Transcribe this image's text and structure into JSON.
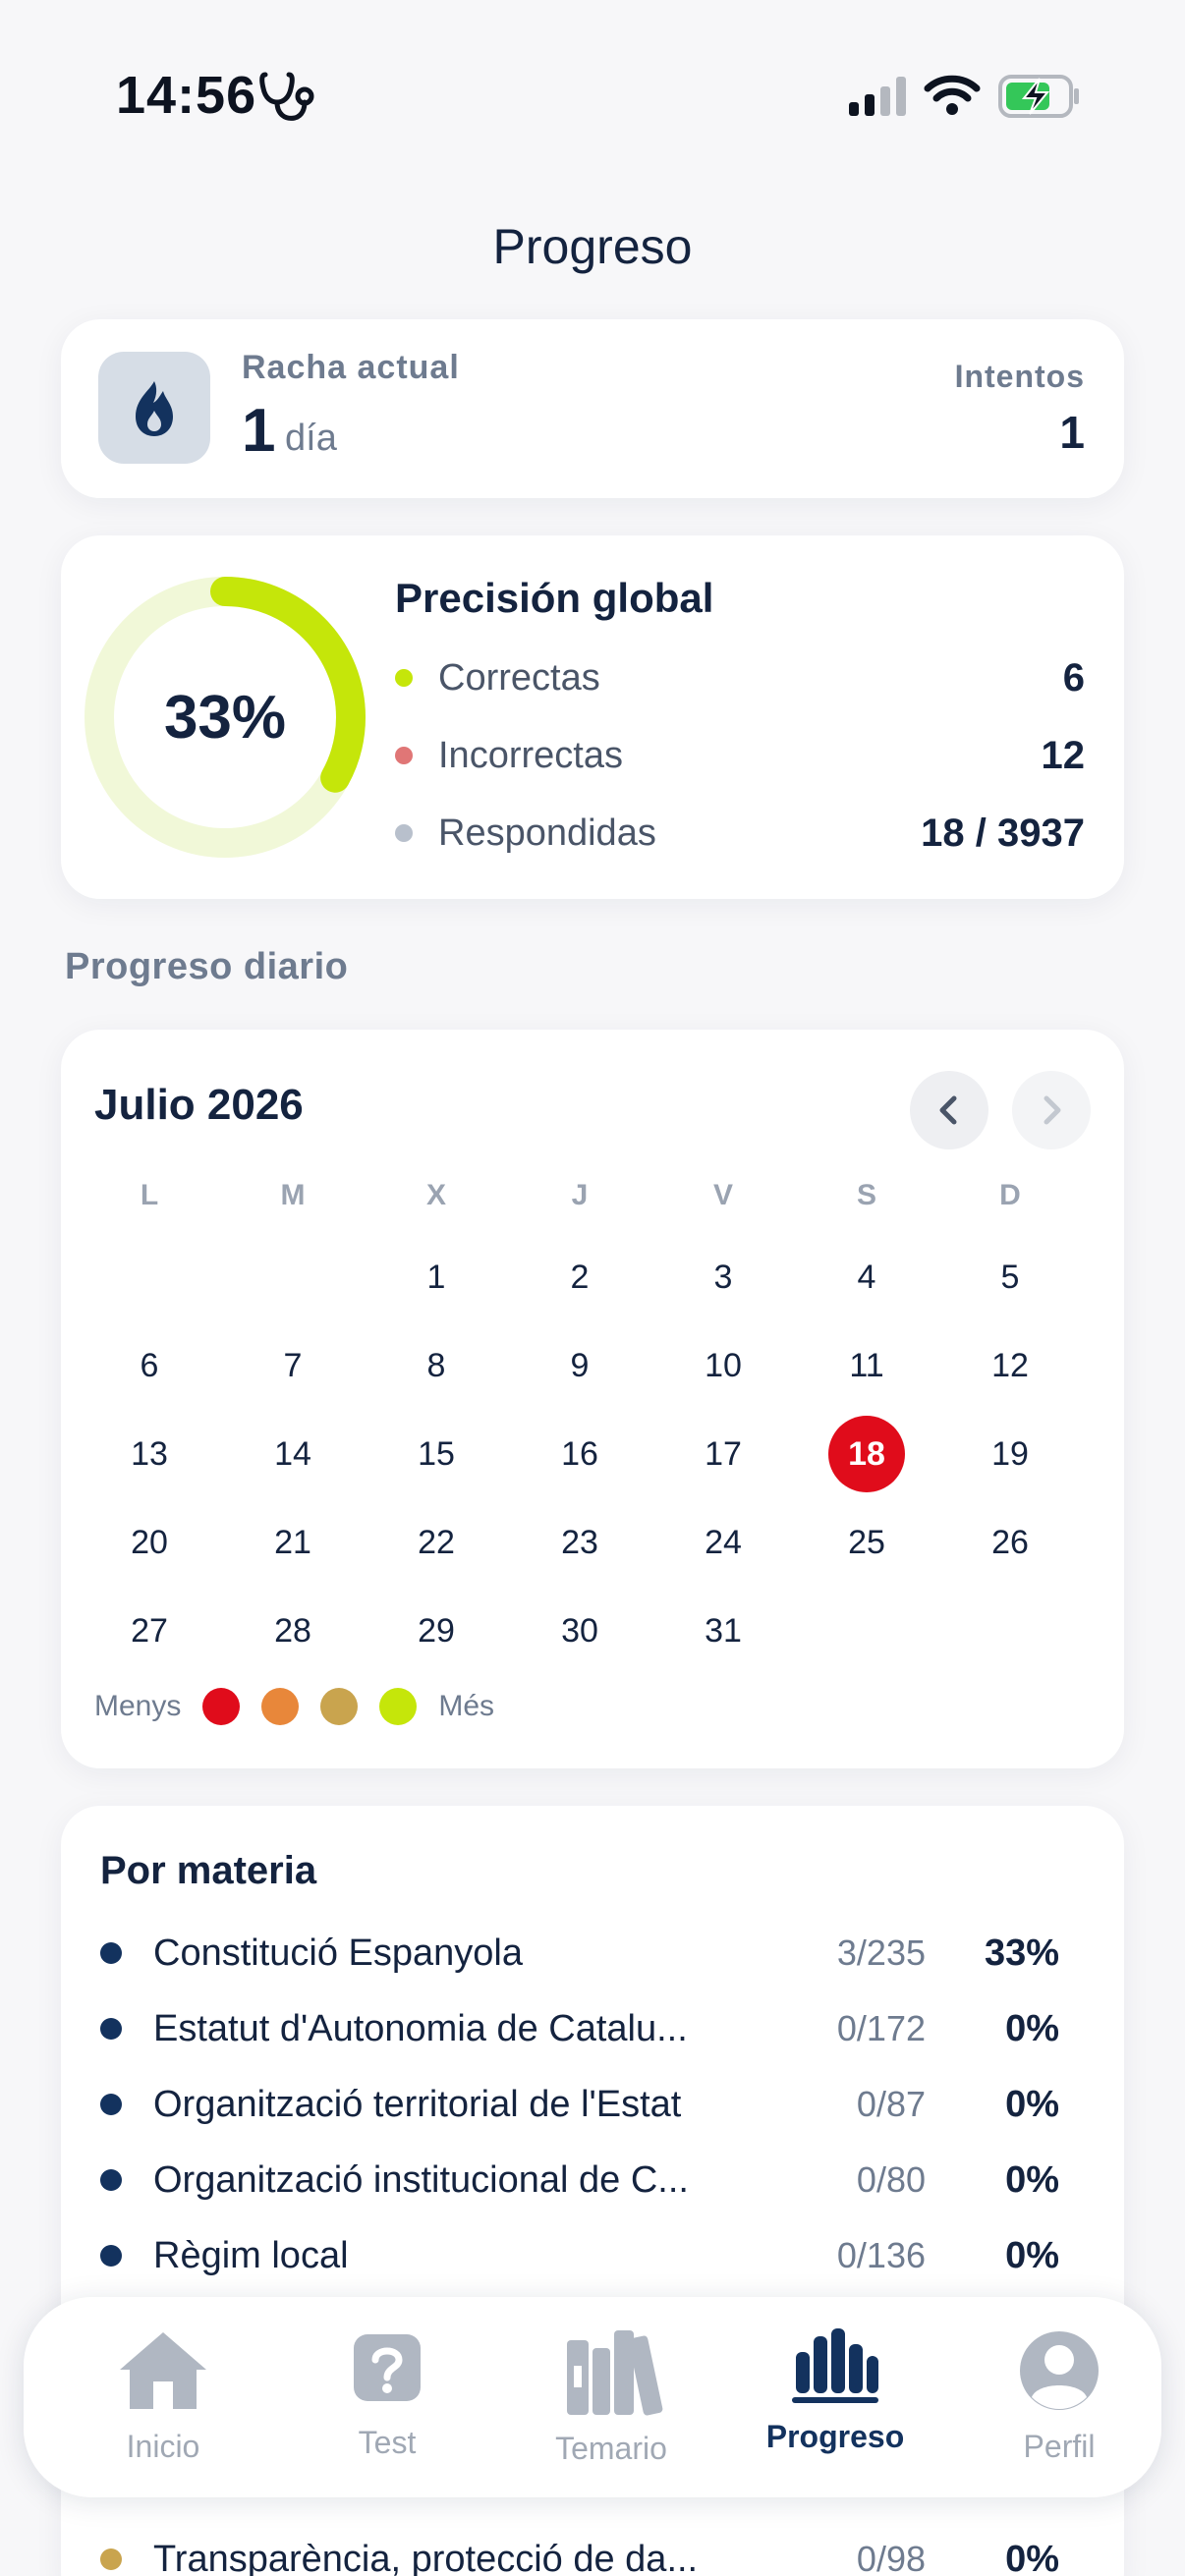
{
  "status_bar": {
    "time": "14:56"
  },
  "page": {
    "title": "Progreso"
  },
  "streak": {
    "label": "Racha actual",
    "value": "1",
    "unit": "día",
    "attempts_label": "Intentos",
    "attempts_value": "1"
  },
  "precision": {
    "percent_text": "33%",
    "percent": 33,
    "title": "Precisión global",
    "rows": [
      {
        "label": "Correctas",
        "value": "6",
        "color": "#c5e60a"
      },
      {
        "label": "Incorrectas",
        "value": "12",
        "color": "#e07676"
      },
      {
        "label": "Respondidas",
        "value": "18 / 3937",
        "color": "#b8c0cc"
      }
    ]
  },
  "daily": {
    "section_label": "Progreso diario"
  },
  "calendar": {
    "month_title": "Julio 2026",
    "weekdays": [
      "L",
      "M",
      "X",
      "J",
      "V",
      "S",
      "D"
    ],
    "days": [
      "",
      "",
      "1",
      "2",
      "3",
      "4",
      "5",
      "6",
      "7",
      "8",
      "9",
      "10",
      "11",
      "12",
      "13",
      "14",
      "15",
      "16",
      "17",
      "18",
      "19",
      "20",
      "21",
      "22",
      "23",
      "24",
      "25",
      "26",
      "27",
      "28",
      "29",
      "30",
      "31"
    ],
    "today": "18",
    "legend": {
      "less": "Menys",
      "more": "Més",
      "colors": [
        "#e00c1b",
        "#e8873a",
        "#c9a44e",
        "#c5e60a"
      ]
    }
  },
  "subjects": {
    "title": "Por materia",
    "items": [
      {
        "name": "Constitució Espanyola",
        "count": "3/235",
        "pct": "33%",
        "color": "#13325e"
      },
      {
        "name": "Estatut d'Autonomia de Catalu...",
        "count": "0/172",
        "pct": "0%",
        "color": "#13325e"
      },
      {
        "name": "Organització territorial de l'Estat",
        "count": "0/87",
        "pct": "0%",
        "color": "#13325e"
      },
      {
        "name": "Organització institucional de C...",
        "count": "0/80",
        "pct": "0%",
        "color": "#13325e"
      },
      {
        "name": "Règim local",
        "count": "0/136",
        "pct": "0%",
        "color": "#13325e"
      },
      {
        "name": "Transparència, protecció de da...",
        "count": "0/98",
        "pct": "0%",
        "color": "#c9a44e"
      }
    ]
  },
  "tabbar": {
    "tabs": [
      {
        "label": "Inicio",
        "icon": "home-icon"
      },
      {
        "label": "Test",
        "icon": "question-icon"
      },
      {
        "label": "Temario",
        "icon": "books-icon"
      },
      {
        "label": "Progreso",
        "icon": "bar-chart-icon",
        "active": true
      },
      {
        "label": "Perfil",
        "icon": "person-icon"
      }
    ]
  }
}
